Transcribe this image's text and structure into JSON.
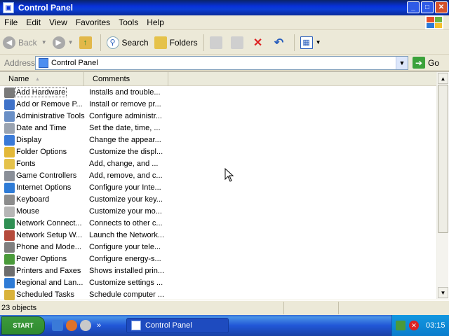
{
  "window": {
    "title": "Control Panel"
  },
  "menu": [
    "File",
    "Edit",
    "View",
    "Favorites",
    "Tools",
    "Help"
  ],
  "toolbar": {
    "back": "Back",
    "search": "Search",
    "folders": "Folders"
  },
  "address": {
    "label": "Address",
    "value": "Control Panel",
    "go": "Go"
  },
  "columns": {
    "name": "Name",
    "comments": "Comments"
  },
  "items": [
    {
      "name": "Add Hardware",
      "comment": "Installs and trouble...",
      "color": "#7a7a7a"
    },
    {
      "name": "Add or Remove P...",
      "comment": "Install or remove pr...",
      "color": "#3f72c9"
    },
    {
      "name": "Administrative Tools",
      "comment": "Configure administr...",
      "color": "#6a8fc6"
    },
    {
      "name": "Date and Time",
      "comment": "Set the date, time, ...",
      "color": "#9aa3b0"
    },
    {
      "name": "Display",
      "comment": "Change the appear...",
      "color": "#3a7ad8"
    },
    {
      "name": "Folder Options",
      "comment": "Customize the displ...",
      "color": "#e3b838"
    },
    {
      "name": "Fonts",
      "comment": "Add, change, and ...",
      "color": "#e5c24a"
    },
    {
      "name": "Game Controllers",
      "comment": "Add, remove, and c...",
      "color": "#8a8f98"
    },
    {
      "name": "Internet Options",
      "comment": "Configure your Inte...",
      "color": "#2e7bd6"
    },
    {
      "name": "Keyboard",
      "comment": "Customize your key...",
      "color": "#8d8d8d"
    },
    {
      "name": "Mouse",
      "comment": "Customize your mo...",
      "color": "#b6b6b6"
    },
    {
      "name": "Network Connect...",
      "comment": "Connects to other c...",
      "color": "#2f8f53"
    },
    {
      "name": "Network Setup W...",
      "comment": "Launch the Network...",
      "color": "#b54a3b"
    },
    {
      "name": "Phone and Mode...",
      "comment": "Configure your tele...",
      "color": "#7f7f7f"
    },
    {
      "name": "Power Options",
      "comment": "Configure energy-s...",
      "color": "#4a9a3a"
    },
    {
      "name": "Printers and Faxes",
      "comment": "Shows installed prin...",
      "color": "#6d6d6d"
    },
    {
      "name": "Regional and Lan...",
      "comment": "Customize settings ...",
      "color": "#2e7bd6"
    },
    {
      "name": "Scheduled Tasks",
      "comment": "Schedule computer ...",
      "color": "#d9b23a"
    }
  ],
  "status": {
    "objects": "23 objects"
  },
  "taskbar": {
    "start": "START",
    "task": "Control Panel",
    "clock": "03:15"
  }
}
